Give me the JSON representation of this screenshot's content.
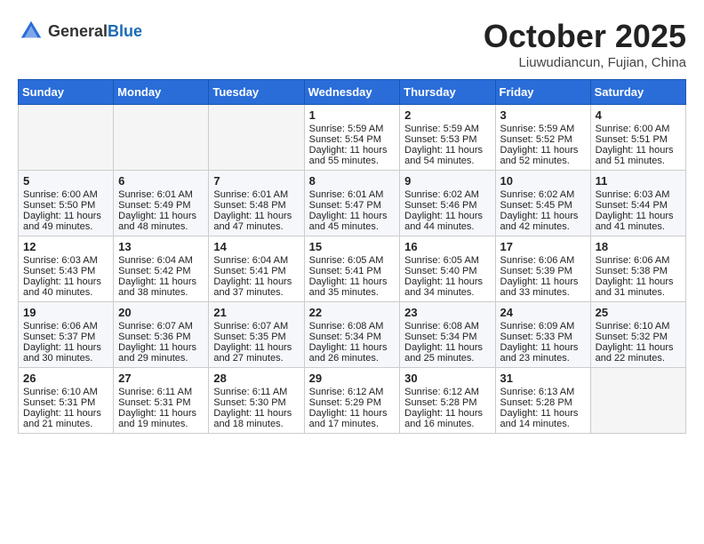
{
  "header": {
    "logo_general": "General",
    "logo_blue": "Blue",
    "month": "October 2025",
    "location": "Liuwudiancun, Fujian, China"
  },
  "weekdays": [
    "Sunday",
    "Monday",
    "Tuesday",
    "Wednesday",
    "Thursday",
    "Friday",
    "Saturday"
  ],
  "weeks": [
    [
      {
        "day": "",
        "sunrise": "",
        "sunset": "",
        "daylight": "",
        "empty": true
      },
      {
        "day": "",
        "sunrise": "",
        "sunset": "",
        "daylight": "",
        "empty": true
      },
      {
        "day": "",
        "sunrise": "",
        "sunset": "",
        "daylight": "",
        "empty": true
      },
      {
        "day": "1",
        "sunrise": "Sunrise: 5:59 AM",
        "sunset": "Sunset: 5:54 PM",
        "daylight": "Daylight: 11 hours and 55 minutes."
      },
      {
        "day": "2",
        "sunrise": "Sunrise: 5:59 AM",
        "sunset": "Sunset: 5:53 PM",
        "daylight": "Daylight: 11 hours and 54 minutes."
      },
      {
        "day": "3",
        "sunrise": "Sunrise: 5:59 AM",
        "sunset": "Sunset: 5:52 PM",
        "daylight": "Daylight: 11 hours and 52 minutes."
      },
      {
        "day": "4",
        "sunrise": "Sunrise: 6:00 AM",
        "sunset": "Sunset: 5:51 PM",
        "daylight": "Daylight: 11 hours and 51 minutes."
      }
    ],
    [
      {
        "day": "5",
        "sunrise": "Sunrise: 6:00 AM",
        "sunset": "Sunset: 5:50 PM",
        "daylight": "Daylight: 11 hours and 49 minutes."
      },
      {
        "day": "6",
        "sunrise": "Sunrise: 6:01 AM",
        "sunset": "Sunset: 5:49 PM",
        "daylight": "Daylight: 11 hours and 48 minutes."
      },
      {
        "day": "7",
        "sunrise": "Sunrise: 6:01 AM",
        "sunset": "Sunset: 5:48 PM",
        "daylight": "Daylight: 11 hours and 47 minutes."
      },
      {
        "day": "8",
        "sunrise": "Sunrise: 6:01 AM",
        "sunset": "Sunset: 5:47 PM",
        "daylight": "Daylight: 11 hours and 45 minutes."
      },
      {
        "day": "9",
        "sunrise": "Sunrise: 6:02 AM",
        "sunset": "Sunset: 5:46 PM",
        "daylight": "Daylight: 11 hours and 44 minutes."
      },
      {
        "day": "10",
        "sunrise": "Sunrise: 6:02 AM",
        "sunset": "Sunset: 5:45 PM",
        "daylight": "Daylight: 11 hours and 42 minutes."
      },
      {
        "day": "11",
        "sunrise": "Sunrise: 6:03 AM",
        "sunset": "Sunset: 5:44 PM",
        "daylight": "Daylight: 11 hours and 41 minutes."
      }
    ],
    [
      {
        "day": "12",
        "sunrise": "Sunrise: 6:03 AM",
        "sunset": "Sunset: 5:43 PM",
        "daylight": "Daylight: 11 hours and 40 minutes."
      },
      {
        "day": "13",
        "sunrise": "Sunrise: 6:04 AM",
        "sunset": "Sunset: 5:42 PM",
        "daylight": "Daylight: 11 hours and 38 minutes."
      },
      {
        "day": "14",
        "sunrise": "Sunrise: 6:04 AM",
        "sunset": "Sunset: 5:41 PM",
        "daylight": "Daylight: 11 hours and 37 minutes."
      },
      {
        "day": "15",
        "sunrise": "Sunrise: 6:05 AM",
        "sunset": "Sunset: 5:41 PM",
        "daylight": "Daylight: 11 hours and 35 minutes."
      },
      {
        "day": "16",
        "sunrise": "Sunrise: 6:05 AM",
        "sunset": "Sunset: 5:40 PM",
        "daylight": "Daylight: 11 hours and 34 minutes."
      },
      {
        "day": "17",
        "sunrise": "Sunrise: 6:06 AM",
        "sunset": "Sunset: 5:39 PM",
        "daylight": "Daylight: 11 hours and 33 minutes."
      },
      {
        "day": "18",
        "sunrise": "Sunrise: 6:06 AM",
        "sunset": "Sunset: 5:38 PM",
        "daylight": "Daylight: 11 hours and 31 minutes."
      }
    ],
    [
      {
        "day": "19",
        "sunrise": "Sunrise: 6:06 AM",
        "sunset": "Sunset: 5:37 PM",
        "daylight": "Daylight: 11 hours and 30 minutes."
      },
      {
        "day": "20",
        "sunrise": "Sunrise: 6:07 AM",
        "sunset": "Sunset: 5:36 PM",
        "daylight": "Daylight: 11 hours and 29 minutes."
      },
      {
        "day": "21",
        "sunrise": "Sunrise: 6:07 AM",
        "sunset": "Sunset: 5:35 PM",
        "daylight": "Daylight: 11 hours and 27 minutes."
      },
      {
        "day": "22",
        "sunrise": "Sunrise: 6:08 AM",
        "sunset": "Sunset: 5:34 PM",
        "daylight": "Daylight: 11 hours and 26 minutes."
      },
      {
        "day": "23",
        "sunrise": "Sunrise: 6:08 AM",
        "sunset": "Sunset: 5:34 PM",
        "daylight": "Daylight: 11 hours and 25 minutes."
      },
      {
        "day": "24",
        "sunrise": "Sunrise: 6:09 AM",
        "sunset": "Sunset: 5:33 PM",
        "daylight": "Daylight: 11 hours and 23 minutes."
      },
      {
        "day": "25",
        "sunrise": "Sunrise: 6:10 AM",
        "sunset": "Sunset: 5:32 PM",
        "daylight": "Daylight: 11 hours and 22 minutes."
      }
    ],
    [
      {
        "day": "26",
        "sunrise": "Sunrise: 6:10 AM",
        "sunset": "Sunset: 5:31 PM",
        "daylight": "Daylight: 11 hours and 21 minutes."
      },
      {
        "day": "27",
        "sunrise": "Sunrise: 6:11 AM",
        "sunset": "Sunset: 5:31 PM",
        "daylight": "Daylight: 11 hours and 19 minutes."
      },
      {
        "day": "28",
        "sunrise": "Sunrise: 6:11 AM",
        "sunset": "Sunset: 5:30 PM",
        "daylight": "Daylight: 11 hours and 18 minutes."
      },
      {
        "day": "29",
        "sunrise": "Sunrise: 6:12 AM",
        "sunset": "Sunset: 5:29 PM",
        "daylight": "Daylight: 11 hours and 17 minutes."
      },
      {
        "day": "30",
        "sunrise": "Sunrise: 6:12 AM",
        "sunset": "Sunset: 5:28 PM",
        "daylight": "Daylight: 11 hours and 16 minutes."
      },
      {
        "day": "31",
        "sunrise": "Sunrise: 6:13 AM",
        "sunset": "Sunset: 5:28 PM",
        "daylight": "Daylight: 11 hours and 14 minutes."
      },
      {
        "day": "",
        "sunrise": "",
        "sunset": "",
        "daylight": "",
        "empty": true
      }
    ]
  ]
}
